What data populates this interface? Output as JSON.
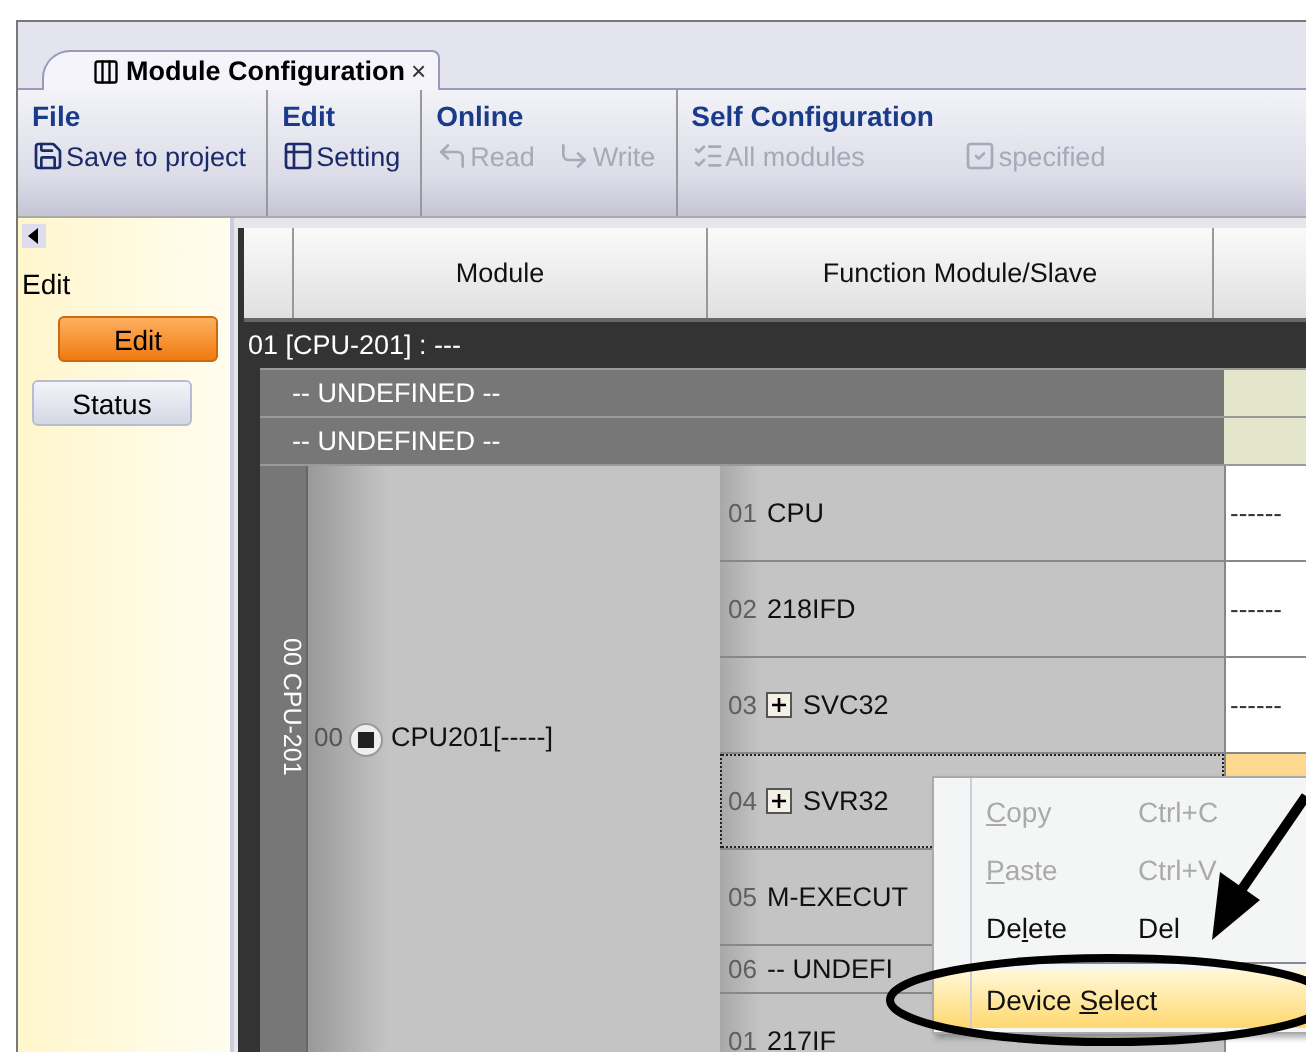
{
  "tab": {
    "title": "Module Configuration",
    "close": "×",
    "selected": true
  },
  "toolbar": {
    "groups": [
      {
        "label": "File",
        "buttons": [
          {
            "label": "Save to project",
            "disabled": false
          }
        ]
      },
      {
        "label": "Edit",
        "buttons": [
          {
            "label": "Setting",
            "disabled": false
          }
        ]
      },
      {
        "label": "Online",
        "buttons": [
          {
            "label": "Read",
            "disabled": true
          },
          {
            "label": "Write",
            "disabled": true
          }
        ]
      },
      {
        "label": "Self Configuration",
        "buttons": [
          {
            "label": "All modules",
            "disabled": true
          },
          {
            "label": "specified",
            "disabled": true
          }
        ]
      }
    ]
  },
  "side_panel": {
    "heading": "Edit",
    "modes": [
      {
        "label": "Edit",
        "selected": true
      },
      {
        "label": "Status",
        "selected": false
      }
    ]
  },
  "table": {
    "columns": [
      "Module",
      "Function Module/Slave"
    ],
    "group_row": "01 [CPU-201] : ---",
    "undefined_rows": [
      "-- UNDEFINED --",
      "-- UNDEFINED --"
    ],
    "rack": {
      "label": "00 CPU-201",
      "slot": "00",
      "module": "CPU201[-----]",
      "slaves": [
        {
          "number": "01",
          "name": "CPU",
          "expandable": false,
          "focused": false,
          "value": "------"
        },
        {
          "number": "02",
          "name": "218IFD",
          "expandable": false,
          "focused": false,
          "value": "------"
        },
        {
          "number": "03",
          "name": "SVC32",
          "expandable": true,
          "focused": false,
          "value": "------"
        },
        {
          "number": "04",
          "name": "SVR32",
          "expandable": true,
          "focused": true
        },
        {
          "number": "05",
          "name": "M-EXECUT",
          "expandable": false,
          "focused": false
        },
        {
          "number": "06",
          "name": "-- UNDEFI",
          "expandable": false,
          "focused": false
        }
      ]
    },
    "next_row": {
      "number": "01",
      "name": "217IF"
    }
  },
  "context_menu": {
    "items": [
      {
        "kind": "item",
        "access_key": "C",
        "label_after": "opy",
        "shortcut": "Ctrl+C",
        "disabled": true,
        "selected": false
      },
      {
        "kind": "item",
        "access_key": "P",
        "label_after": "aste",
        "shortcut": "Ctrl+V",
        "disabled": true,
        "selected": false
      },
      {
        "kind": "item",
        "label_before": "De",
        "access_key": "l",
        "label_after": "ete",
        "shortcut": "Del",
        "disabled": false,
        "selected": false
      },
      {
        "kind": "separator"
      },
      {
        "kind": "item",
        "label_before": "Device ",
        "access_key": "S",
        "label_after": "elect",
        "disabled": false,
        "selected": true
      }
    ]
  }
}
